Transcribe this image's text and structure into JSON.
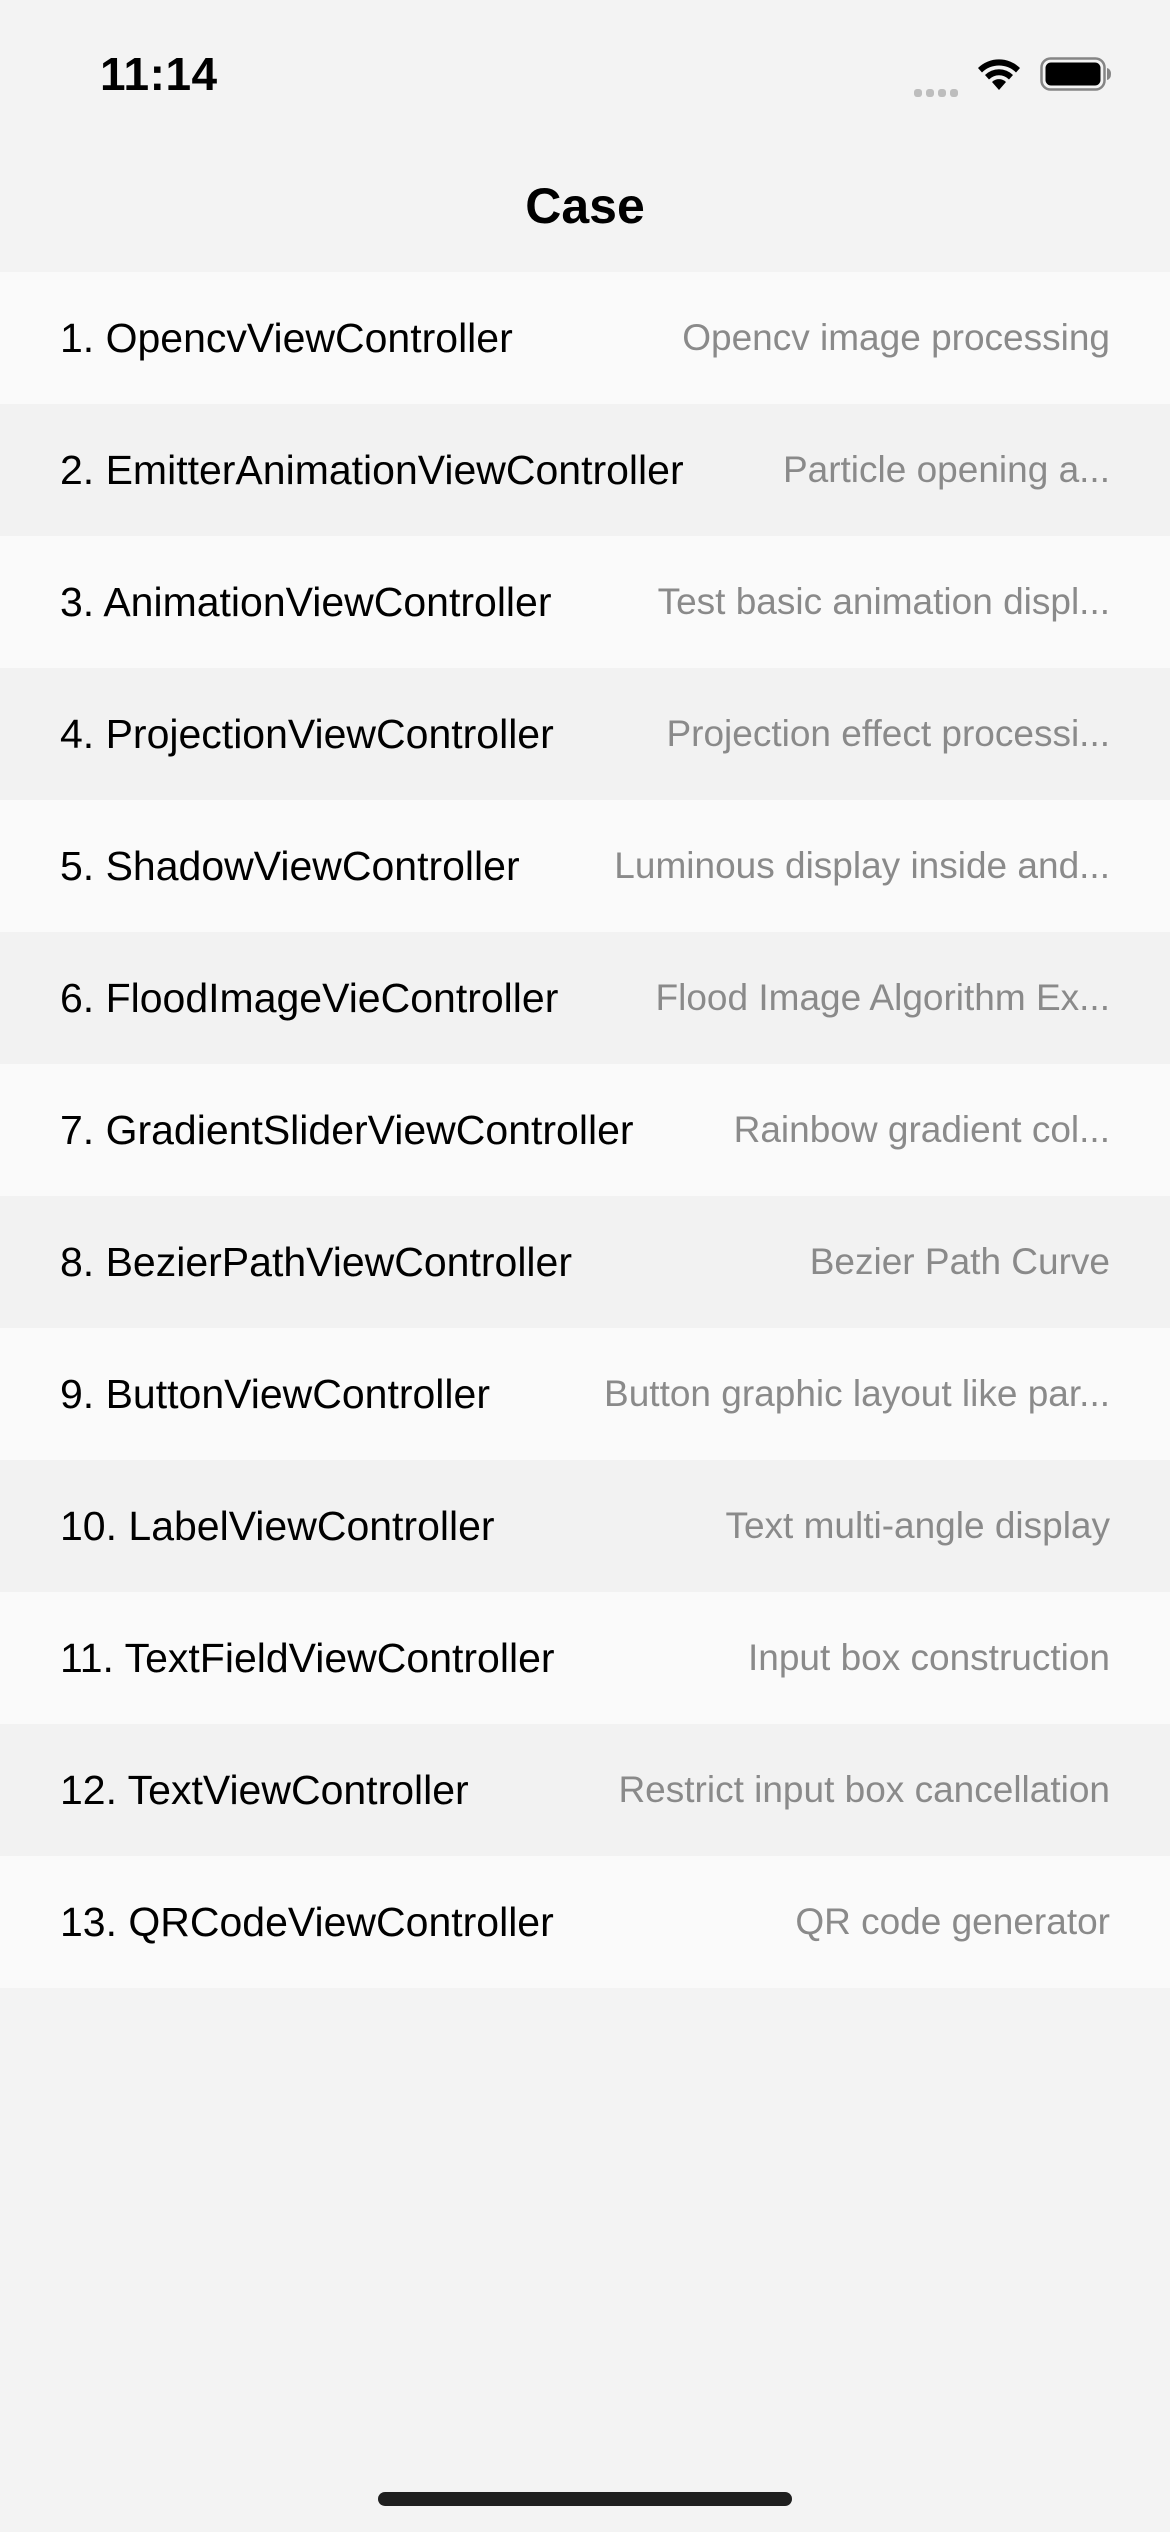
{
  "status_bar": {
    "time": "11:14",
    "icons": [
      "cellular-signal-icon",
      "wifi-icon",
      "battery-icon"
    ]
  },
  "nav": {
    "title": "Case"
  },
  "cases": [
    {
      "title": "1. OpencvViewController",
      "subtitle": "Opencv image processing"
    },
    {
      "title": "2. EmitterAnimationViewController",
      "subtitle": "Particle opening a..."
    },
    {
      "title": "3. AnimationViewController",
      "subtitle": "Test basic animation displ..."
    },
    {
      "title": "4. ProjectionViewController",
      "subtitle": "Projection effect processi..."
    },
    {
      "title": "5. ShadowViewController",
      "subtitle": "Luminous display inside and..."
    },
    {
      "title": "6. FloodImageVieController",
      "subtitle": "Flood Image Algorithm Ex..."
    },
    {
      "title": "7. GradientSliderViewController",
      "subtitle": "Rainbow gradient col..."
    },
    {
      "title": "8. BezierPathViewController",
      "subtitle": "Bezier Path Curve"
    },
    {
      "title": "9. ButtonViewController",
      "subtitle": "Button graphic layout like par..."
    },
    {
      "title": "10. LabelViewController",
      "subtitle": "Text multi-angle display"
    },
    {
      "title": "11. TextFieldViewController",
      "subtitle": "Input box construction"
    },
    {
      "title": "12. TextViewController",
      "subtitle": "Restrict input box cancellation"
    },
    {
      "title": "13. QRCodeViewController",
      "subtitle": "QR code generator"
    }
  ],
  "colors": {
    "background": "#f3f3f3",
    "row_light": "#fafafa",
    "row_dark": "#f2f2f2",
    "title_text": "#000000",
    "subtitle_text": "#8a8a8a"
  }
}
